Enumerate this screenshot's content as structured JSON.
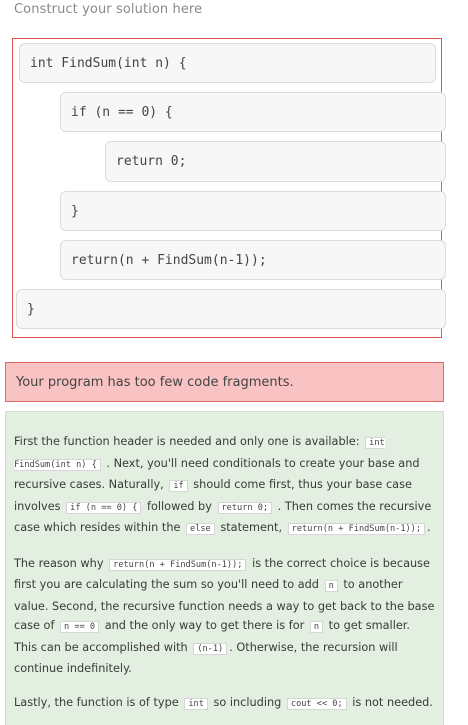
{
  "heading": "Construct your solution here",
  "blocks": [
    "int FindSum(int n) {",
    "if (n == 0) {",
    "return 0;",
    "}",
    "return(n + FindSum(n-1));",
    "}"
  ],
  "alert": "Your program has too few code fragments.",
  "feedback": {
    "p1": {
      "t1": "First the function header is needed and only one is available:",
      "c1": "int FindSum(int n) {",
      "t2": ". Next, you'll need conditionals to create your base and recursive cases. Naturally,",
      "c2": "if",
      "t3": "should come first, thus your base case involves",
      "c3": "if (n == 0) {",
      "t4": "followed by",
      "c4": "return 0;",
      "t5": ". Then comes the recursive case which resides within the",
      "c5": "else",
      "t6": "statement,",
      "c6": "return(n + FindSum(n-1));",
      "t7": "."
    },
    "p2": {
      "t1": "The reason why",
      "c1": "return(n + FindSum(n-1));",
      "t2": "is the correct choice is because first you are calculating the sum so you'll need to add",
      "c2": "n",
      "t3": "to another value. Second, the recursive function needs a way to get back to the base case of",
      "c3": "n == 0",
      "t4": "and the only way to get there is for",
      "c4": "n",
      "t5": "to get smaller. This can be accomplished with",
      "c5": "(n-1)",
      "t6": ". Otherwise, the recursion will continue indefinitely."
    },
    "p3": {
      "t1": "Lastly, the function is of type",
      "c1": "int",
      "t2": "so including",
      "c2": "cout << 0;",
      "t3": "is not needed."
    }
  }
}
